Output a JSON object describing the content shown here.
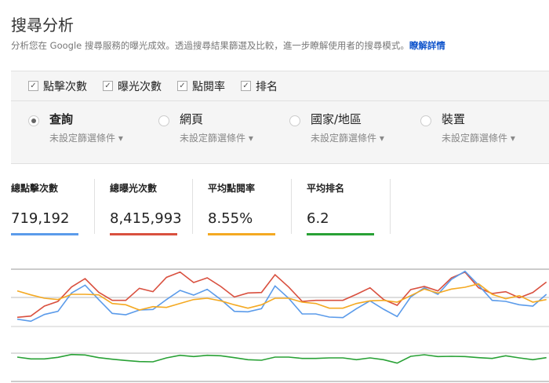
{
  "header": {
    "title": "搜尋分析",
    "description": "分析您在 Google 搜尋服務的曝光成效。透過搜尋結果篩選及比較，進一步瞭解使用者的搜尋模式。",
    "learn_more": "瞭解詳情"
  },
  "metrics_checks": [
    {
      "label": "點擊次數",
      "checked": true
    },
    {
      "label": "曝光次數",
      "checked": true
    },
    {
      "label": "點閱率",
      "checked": true
    },
    {
      "label": "排名",
      "checked": true
    }
  ],
  "dimensions": [
    {
      "label": "查詢",
      "selected": true,
      "filter": "未設定篩選條件"
    },
    {
      "label": "網頁",
      "selected": false,
      "filter": "未設定篩選條件"
    },
    {
      "label": "國家/地區",
      "selected": false,
      "filter": "未設定篩選條件"
    },
    {
      "label": "裝置",
      "selected": false,
      "filter": "未設定篩選條件"
    }
  ],
  "totals": [
    {
      "label": "總點擊次數",
      "value": "719,192",
      "color": "#5b9bea"
    },
    {
      "label": "總曝光次數",
      "value": "8,415,993",
      "color": "#d9503f"
    },
    {
      "label": "平均點閱率",
      "value": "8.55%",
      "color": "#f4a922"
    },
    {
      "label": "平均排名",
      "value": "6.2",
      "color": "#28a135"
    }
  ],
  "chart_data": {
    "type": "line",
    "grid": true,
    "ylim": [
      0,
      429
    ],
    "series": [
      {
        "color": "#d9503f",
        "values": [
          245,
          250,
          288,
          306,
          361,
          393,
          341,
          310,
          310,
          356,
          343,
          398,
          418,
          378,
          396,
          363,
          323,
          338,
          340,
          408,
          361,
          306,
          310,
          310,
          310,
          333,
          358,
          313,
          291,
          351,
          363,
          346,
          396,
          418,
          358,
          336,
          343,
          320,
          340,
          380
        ]
      },
      {
        "color": "#5b9bea",
        "values": [
          238,
          230,
          256,
          268,
          338,
          368,
          313,
          260,
          255,
          273,
          275,
          313,
          348,
          330,
          352,
          313,
          268,
          266,
          278,
          365,
          318,
          258,
          258,
          246,
          244,
          278,
          308,
          276,
          248,
          323,
          358,
          333,
          390,
          421,
          368,
          310,
          306,
          293,
          288,
          333
        ]
      },
      {
        "color": "#f4a922",
        "values": [
          346,
          331,
          318,
          313,
          333,
          333,
          331,
          298,
          293,
          273,
          286,
          283,
          298,
          313,
          318,
          308,
          293,
          280,
          293,
          318,
          318,
          303,
          298,
          280,
          280,
          298,
          308,
          310,
          303,
          328,
          353,
          338,
          353,
          360,
          373,
          333,
          316,
          328,
          303,
          313
        ]
      },
      {
        "color": "#28a135",
        "values": [
          93,
          86,
          86,
          92,
          103,
          101,
          91,
          85,
          80,
          76,
          75,
          90,
          100,
          95,
          100,
          98,
          91,
          83,
          81,
          93,
          93,
          88,
          88,
          90,
          90,
          83,
          90,
          83,
          70,
          96,
          102,
          95,
          96,
          95,
          91,
          88,
          98,
          90,
          83,
          91
        ]
      }
    ]
  }
}
